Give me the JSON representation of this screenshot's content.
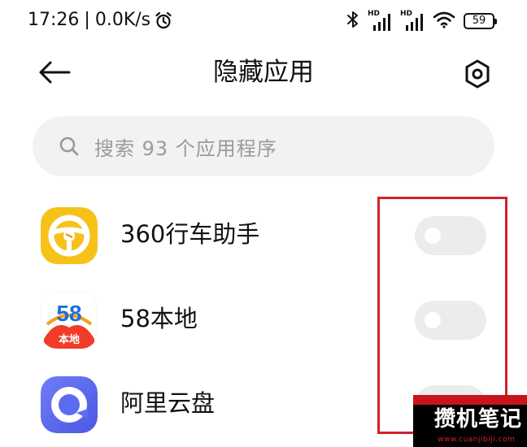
{
  "status_bar": {
    "time": "17:26",
    "separator": "|",
    "network_speed": "0.0K/s",
    "battery": "59",
    "signal_1_label": "HD",
    "signal_2_label": "HD",
    "icons": [
      "alarm-icon",
      "bluetooth-icon",
      "signal-icon",
      "signal-icon",
      "wifi-icon",
      "battery-icon"
    ]
  },
  "header": {
    "title": "隐藏应用",
    "back_icon": "back-arrow-icon",
    "settings_icon": "gear-icon"
  },
  "search": {
    "placeholder": "搜索 93 个应用程序",
    "icon": "search-icon"
  },
  "apps": [
    {
      "name": "360行车助手",
      "icon": "steering-wheel-app-icon",
      "hidden": false,
      "icon_color": "#f6c21a"
    },
    {
      "name": "58本地",
      "icon": "58-local-app-icon",
      "hidden": false,
      "icon_label": "本地",
      "icon_brand": "58"
    },
    {
      "name": "阿里云盘",
      "icon": "aliyun-drive-app-icon",
      "hidden": false,
      "icon_color": "#5b6cf0"
    }
  ],
  "colors": {
    "highlight_border": "#d0222a",
    "toggle_off": "#ececec",
    "search_bg": "#f2f2f2"
  },
  "watermark": {
    "text": "攒机笔记",
    "url": "www.cuanjibiji.com"
  }
}
